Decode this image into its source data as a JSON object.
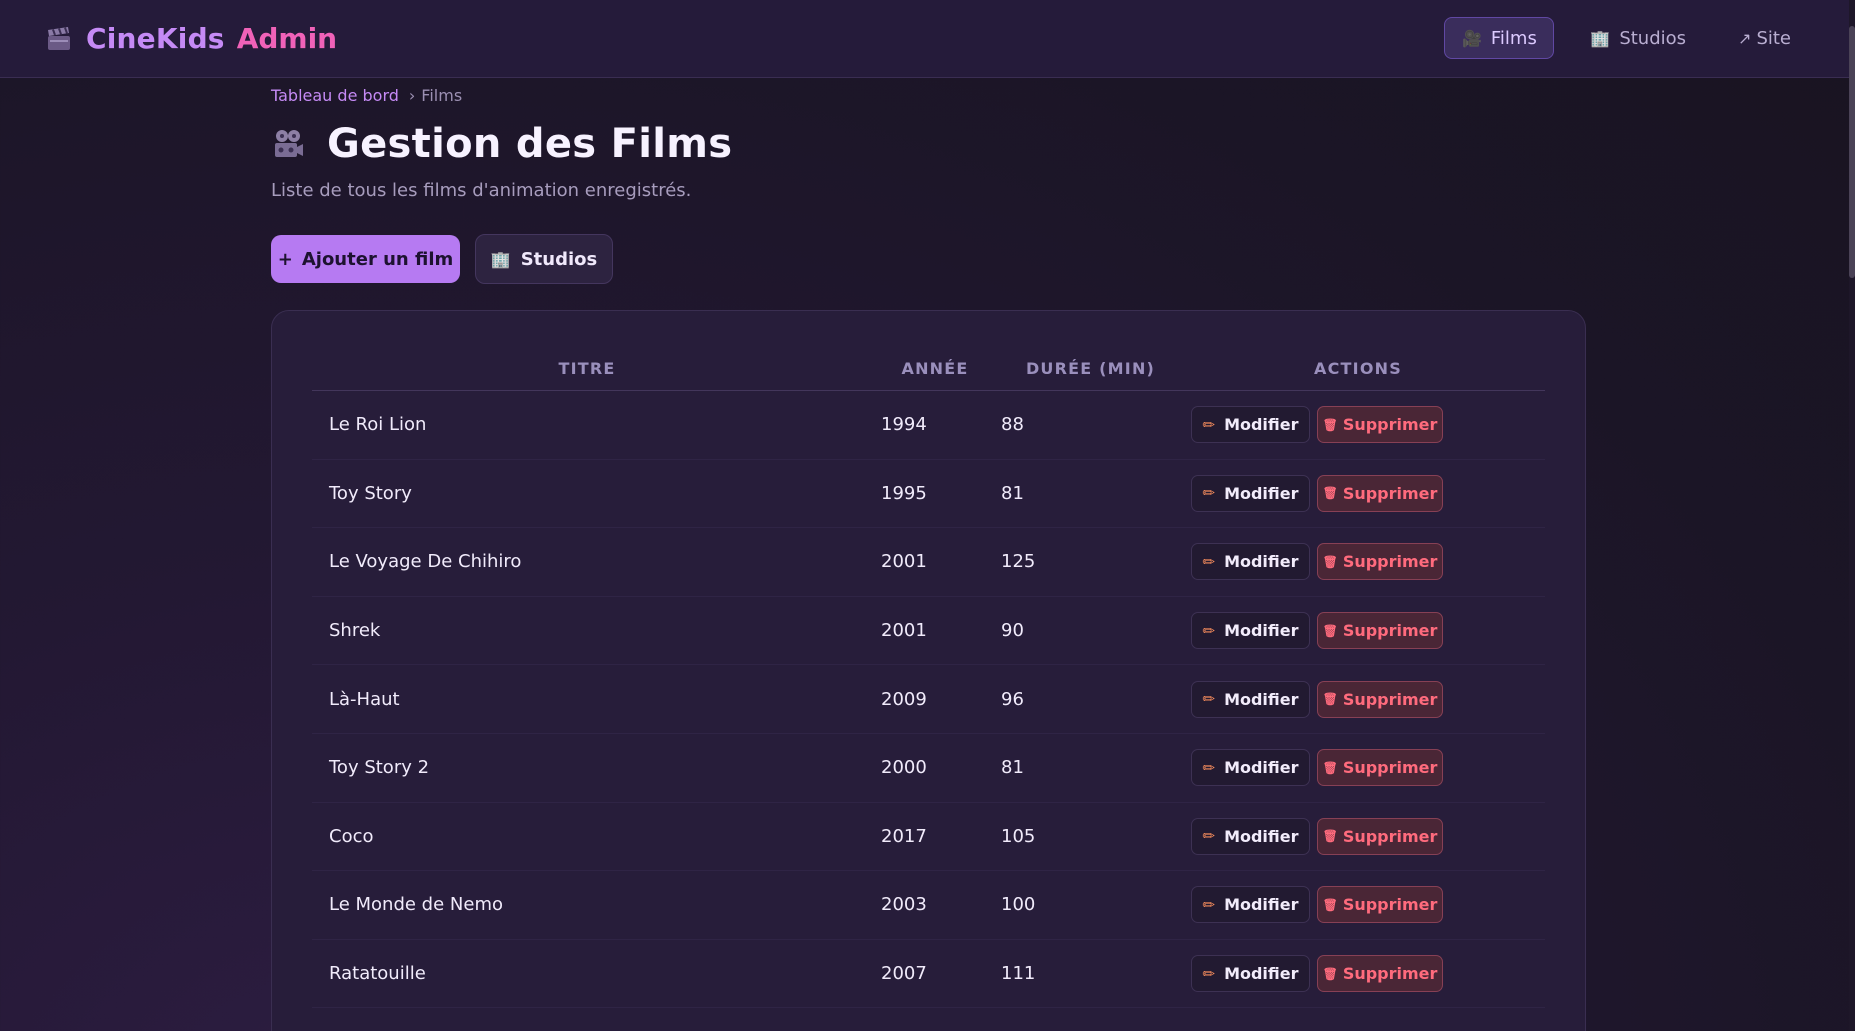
{
  "header": {
    "brand_name": "CineKids",
    "brand_suffix": "Admin",
    "nav": [
      {
        "label": "Films",
        "icon": "film-projector-icon",
        "active": true
      },
      {
        "label": "Studios",
        "icon": "building-icon",
        "active": false
      },
      {
        "label": "Site",
        "icon": "external-arrow-icon",
        "active": false
      }
    ]
  },
  "breadcrumb": {
    "home": "Tableau de bord",
    "separator": "›",
    "current": "Films"
  },
  "page": {
    "title": "Gestion des Films",
    "subtitle": "Liste de tous les films d'animation enregistrés.",
    "add_button": "Ajouter un film",
    "add_icon": "+",
    "studios_button": "Studios"
  },
  "table": {
    "headers": {
      "title": "TITRE",
      "year": "ANNÉE",
      "duration": "DURÉE (MIN)",
      "actions": "ACTIONS"
    },
    "edit_label": "Modifier",
    "delete_label": "Supprimer",
    "rows": [
      {
        "title": "Le Roi Lion",
        "year": "1994",
        "duration": "88"
      },
      {
        "title": "Toy Story",
        "year": "1995",
        "duration": "81"
      },
      {
        "title": "Le Voyage De Chihiro",
        "year": "2001",
        "duration": "125"
      },
      {
        "title": "Shrek",
        "year": "2001",
        "duration": "90"
      },
      {
        "title": "Là-Haut",
        "year": "2009",
        "duration": "96"
      },
      {
        "title": "Toy Story 2",
        "year": "2000",
        "duration": "81"
      },
      {
        "title": "Coco",
        "year": "2017",
        "duration": "105"
      },
      {
        "title": "Le Monde de Nemo",
        "year": "2003",
        "duration": "100"
      },
      {
        "title": "Ratatouille",
        "year": "2007",
        "duration": "111"
      }
    ]
  },
  "colors": {
    "accent": "#b67af2",
    "brand": "#c58af5",
    "brand_suffix": "#f062b8",
    "danger": "#ff6b7d",
    "background": "#1b1526"
  }
}
